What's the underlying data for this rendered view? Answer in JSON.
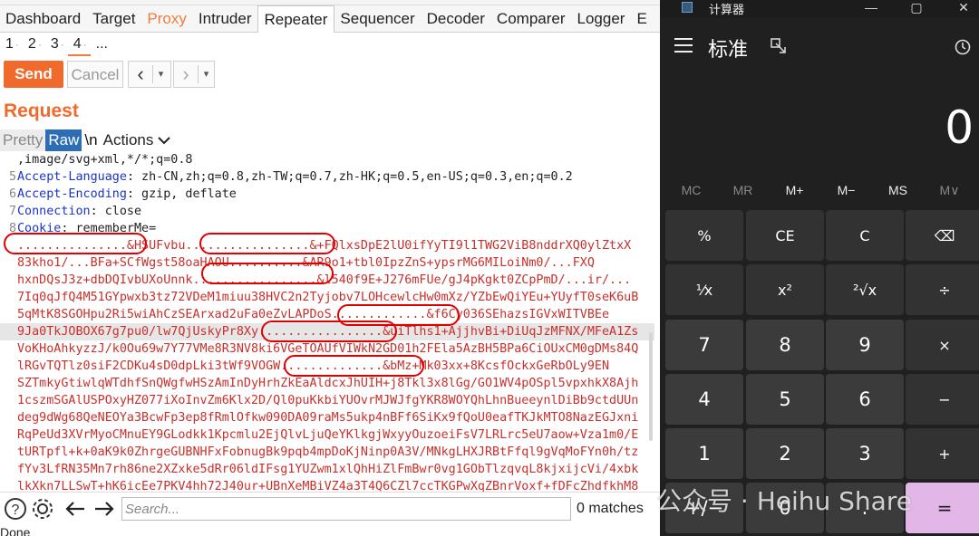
{
  "burp": {
    "main_tabs": [
      "Dashboard",
      "Target",
      "Proxy",
      "Intruder",
      "Repeater",
      "Sequencer",
      "Decoder",
      "Comparer",
      "Logger",
      "E"
    ],
    "sub_tabs": [
      {
        "label": "1",
        "dot": "·"
      },
      {
        "label": "2",
        "dot": "·"
      },
      {
        "label": "3",
        "dot": "·"
      },
      {
        "label": "4",
        "dot": "·"
      },
      {
        "label": "...",
        "dot": ""
      }
    ],
    "toolbar": {
      "send": "Send",
      "cancel": "Cancel"
    },
    "request_title": "Request",
    "view_tabs": {
      "pretty": "Pretty",
      "raw": "Raw",
      "newline": "\\n",
      "actions": "Actions"
    },
    "lines": [
      {
        "n": "",
        "h": "",
        "v": ",image/svg+xml,*/*;q=0.8"
      },
      {
        "n": "5",
        "h": "Accept-Language",
        "v": ": zh-CN,zh;q=0.8,zh-TW;q=0.7,zh-HK;q=0.5,en-US;q=0.3,en;q=0.2"
      },
      {
        "n": "6",
        "h": "Accept-Encoding",
        "v": ": gzip, deflate"
      },
      {
        "n": "7",
        "h": "Connection",
        "v": ": close"
      },
      {
        "n": "8",
        "h": "Cookie",
        "v": ": rememberMe="
      }
    ],
    "cookie_lines": [
      "...............&HSUFvbu.................&+FQlxsDpE2lU0ifYyTI9l1TWG2ViB8nddrXQ0ylZtxX",
      "83kho1/...BFa+SCfWgst58oaHAOU..........&AR9o1+tbl0IpzZnS+ypsrMG6MILoiNm0/...FXQ",
      "hxnDQsJ3z+dbDQIvbUXoUnnk.................&l540f9E+J276mFUe/gJ4pKgkt0ZCpPmD/...ir/...",
      "7Iq0qJfQ4M51GYpwxb3tz72VDeM1miuu38HVC2n2Tyjobv7LOHcewlcHw0mXz/YZbEwQiYEu+YUyfT0seK6uB",
      "5qMtK8SGOHpu2Ri5wiAhCzSEArxad2uFa0eZvLAPDoS.............&f6Cy036SEhazsIGVxWITVBEe",
      "9Ja0TkJOBOX67g7pu0/lw7QjUskyPr8Xy.................&uiTlhs1+AjjhvBi+DiUqJzMFNX/MFeA1Zs",
      "VoKHoAhkyzzJ/k0Ou69w7Y77VMe8R3NV8ki6VGeTOAUfVIWkN2GD01h2FEla5AzBH5BPa6CiOUxCM0gDMs84Q",
      "lRGvTQTlz0siF2CDKu4sD0dpLki3tWf9VOGW..............&bMz+Mk03xx+8KcsfOckxGeRbOLy9EN",
      "SZTmkyGtiwlqWTdhfSnQWgfwHSzAmInDyHrhZkEaAldcxJhUIH+j8Tkl3x8lGg/GO1WV4pOSpl5vpxhkX8Ajh",
      "1cszmSGAlUSPOxyHZ077iXoInvZm6Klx2D/Ql0puKkbiYUOvrMJWJfgYKR8WOYQhLhnBueeynlDiBb9ctdUUn",
      "deg9dWg68QeNEOYa3BcwFp3ep8fRmlOfkw090DA09raMs5ukp4nBFf6SiKx9fQoU0eafTKJkMTO8NazEGJxni",
      "RqPeUd3XVrMyoCMnuEY9GLodkk1Kpcmlu2EjQlvLjuQeYKlkgjWxyyOuzoeiFsV7LRLrc5eU7aow+Vza1m0/E",
      "tURTpfl+k+0aK9k0ZhrgeGUBNHFxFobnugBk9pqb4mpDoKjNinp0A3V/MNkgLHXJRBtFfql9gVqMoFYn0h/tz",
      "fYv3LfRN35Mn7rh86ne2XZxke5dRr06ldIFsg1YUZwm1xlQhHiZlFmBwr0vg1GObTlzqvqL8kjxijcVi/4xbk",
      "lkXkn7LLSwT+hK6icEe7PKV4hh72J40ur+UBnXeMBiVZ4a3T4Q6CZl7ccTKGPwXqZBnrVoxf+fDFcZhdfkhM8"
    ],
    "search": {
      "placeholder": "Search...",
      "matches": "0 matches"
    },
    "status": "Done"
  },
  "calc": {
    "title": "计算器",
    "mode": "标准",
    "display": "0",
    "memory": [
      "MC",
      "MR",
      "M+",
      "M−",
      "MS",
      "M∨"
    ],
    "keys": [
      [
        "%",
        "CE",
        "C",
        "⌫"
      ],
      [
        "¹⁄x",
        "x²",
        "²√x",
        "÷"
      ],
      [
        "7",
        "8",
        "9",
        "×"
      ],
      [
        "4",
        "5",
        "6",
        "−"
      ],
      [
        "1",
        "2",
        "3",
        "+"
      ],
      [
        "+/−",
        "0",
        ".",
        "="
      ]
    ]
  },
  "watermark": "公众号 · Heihu Share"
}
